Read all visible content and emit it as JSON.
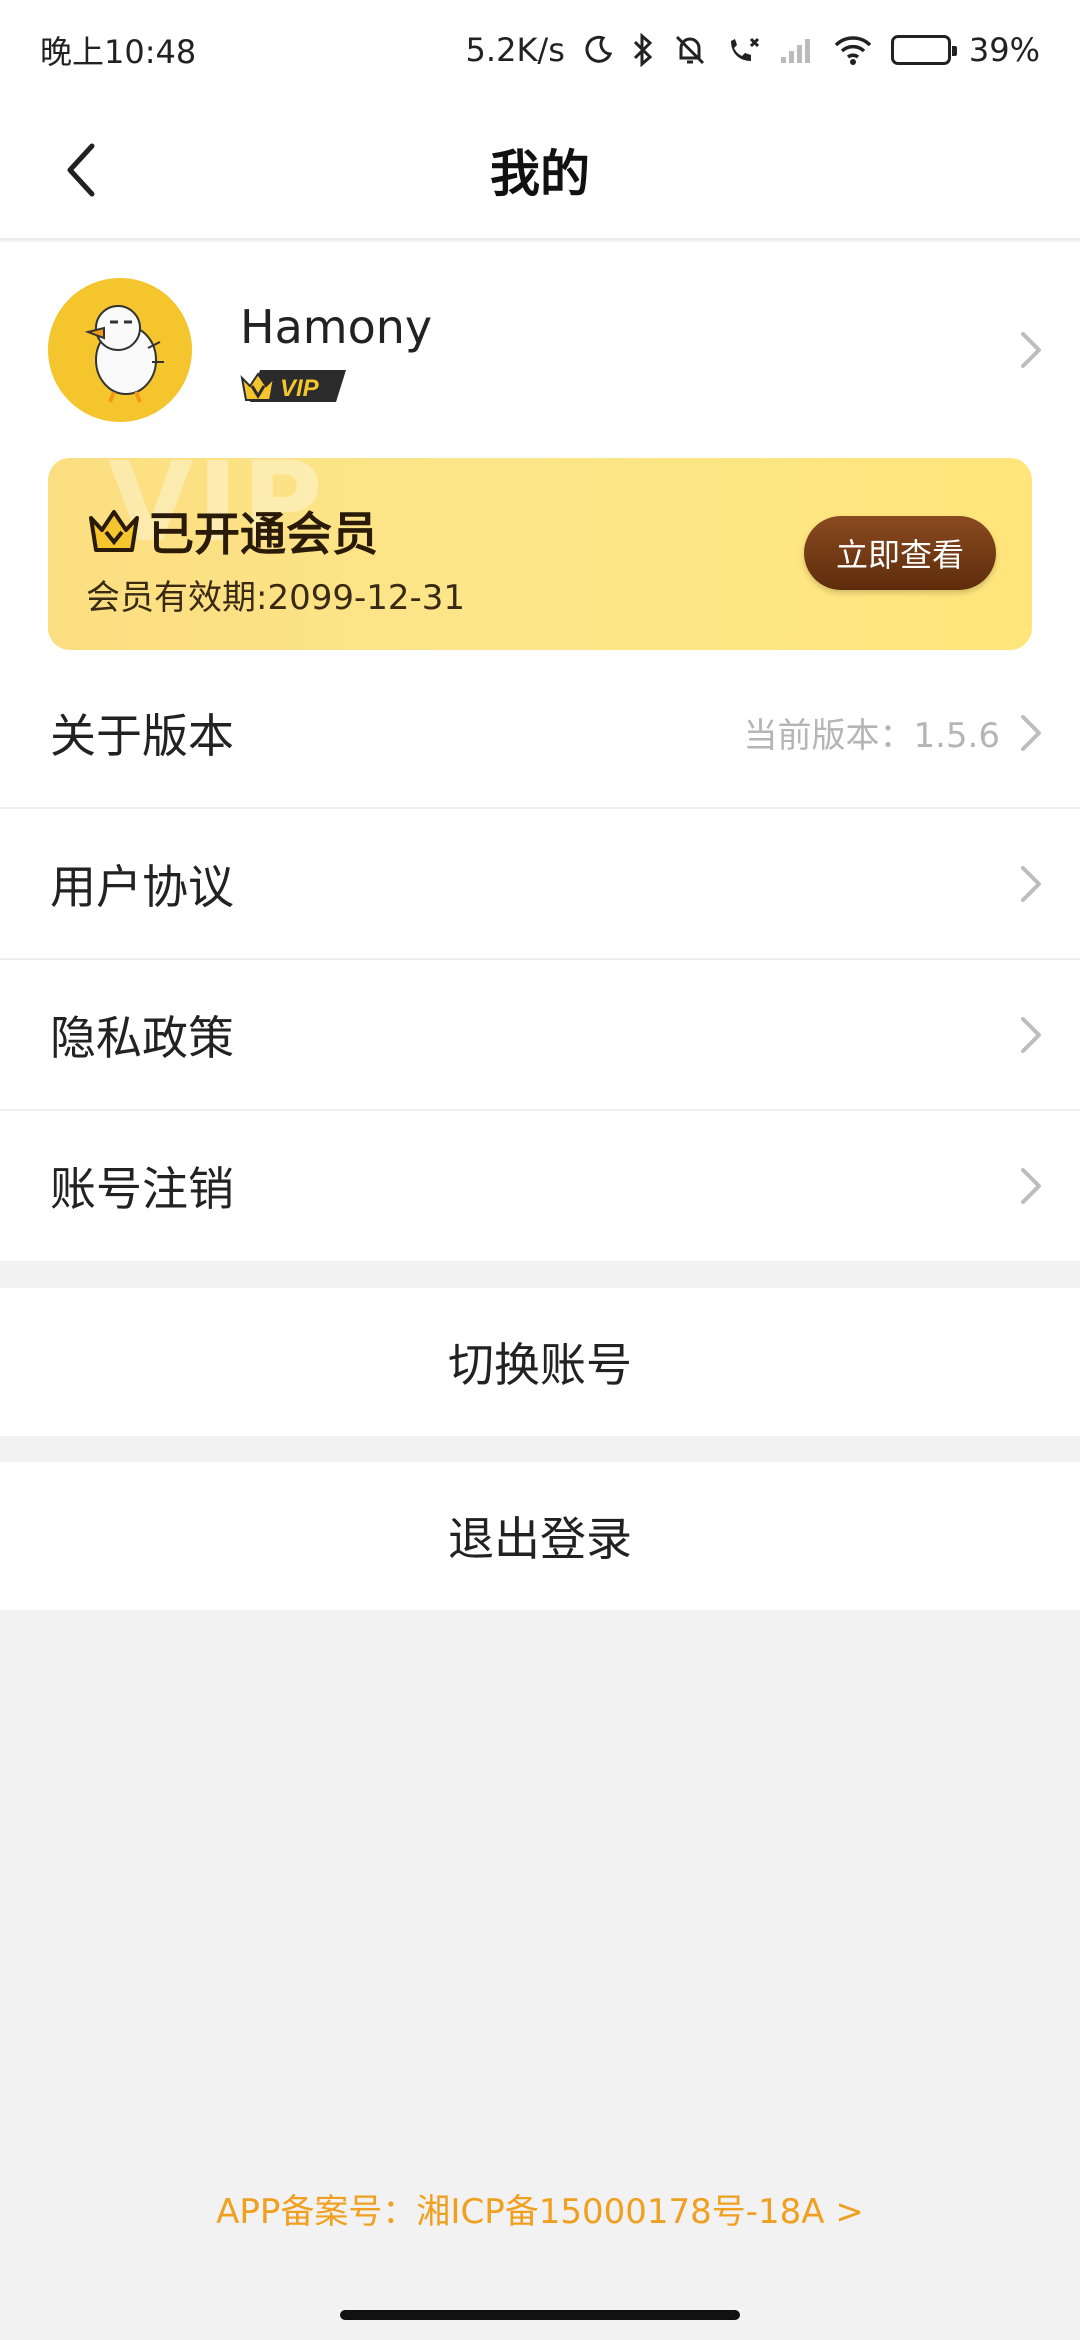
{
  "status_bar": {
    "time": "晚上10:48",
    "net_speed": "5.2K/s",
    "battery_percent": "39%",
    "battery_level": 0.39,
    "icons": [
      "moon-icon",
      "bluetooth-icon",
      "bell-off-icon",
      "call-icon",
      "signal-icon",
      "wifi-icon",
      "battery-icon"
    ]
  },
  "header": {
    "title": "我的",
    "back_icon": "chevron-left-icon"
  },
  "profile": {
    "username": "Hamony",
    "badge": "VIP"
  },
  "member_card": {
    "watermark": "VIP",
    "title": "已开通会员",
    "expiry": "会员有效期:2099-12-31",
    "button_label": "立即查看"
  },
  "menu": {
    "items": [
      {
        "label": "关于版本",
        "value": "当前版本：1.5.6"
      },
      {
        "label": "用户协议",
        "value": ""
      },
      {
        "label": "隐私政策",
        "value": ""
      },
      {
        "label": "账号注销",
        "value": ""
      }
    ]
  },
  "actions": {
    "switch_account": "切换账号",
    "logout": "退出登录"
  },
  "footer": {
    "icp": "APP备案号：湘ICP备15000178号-18A >"
  },
  "colors": {
    "accent_gold": "#fde68a",
    "button_brown": "#6e3510",
    "icp_orange": "#f0a020"
  }
}
